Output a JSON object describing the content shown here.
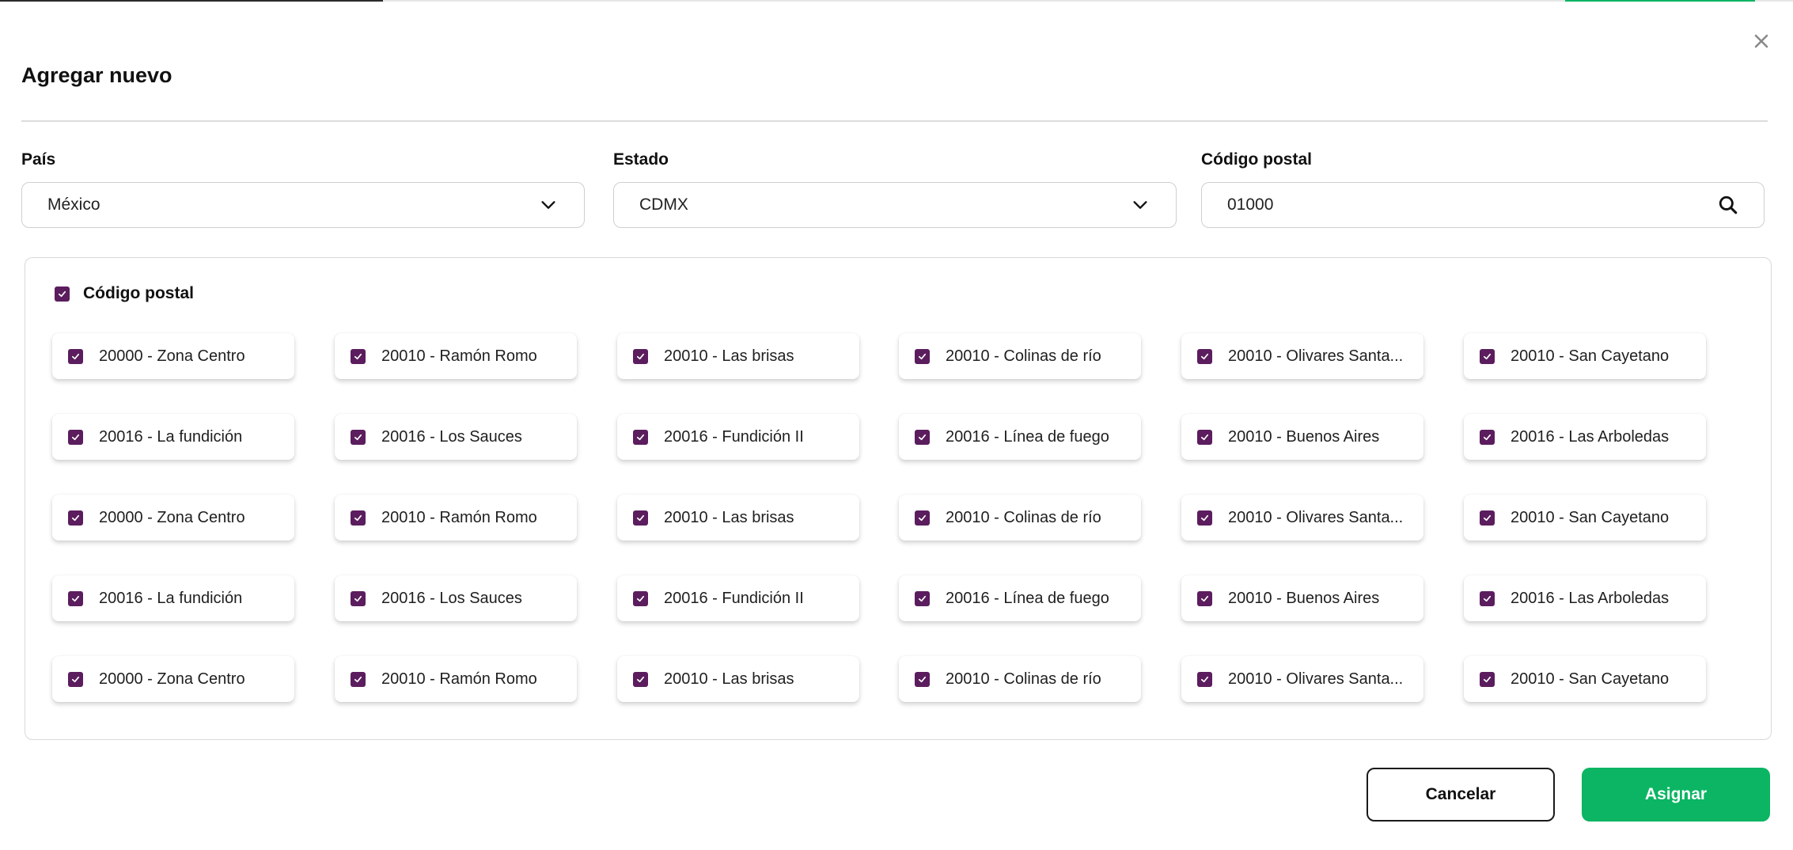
{
  "modal": {
    "title": "Agregar nuevo"
  },
  "fields": {
    "pais": {
      "label": "País",
      "value": "México"
    },
    "estado": {
      "label": "Estado",
      "value": "CDMX"
    },
    "codigo_postal": {
      "label": "Código postal",
      "value": "01000"
    }
  },
  "panel": {
    "header_label": "Código postal",
    "header_checked": true
  },
  "chips": [
    [
      "20000 - Zona Centro",
      "20010 - Ramón Romo",
      "20010 - Las brisas",
      "20010 - Colinas de río",
      "20010 - Olivares Santa...",
      "20010 - San Cayetano"
    ],
    [
      "20016 - La fundición",
      "20016 - Los Sauces",
      "20016 - Fundición II",
      "20016 - Línea de fuego",
      "20010 - Buenos Aires",
      "20016 - Las Arboledas"
    ],
    [
      "20000 - Zona Centro",
      "20010 - Ramón Romo",
      "20010 - Las brisas",
      "20010 - Colinas de río",
      "20010 - Olivares Santa...",
      "20010 - San Cayetano"
    ],
    [
      "20016 - La fundición",
      "20016 - Los Sauces",
      "20016 - Fundición II",
      "20016 - Línea de fuego",
      "20010 - Buenos Aires",
      "20016 - Las Arboledas"
    ],
    [
      "20000 - Zona Centro",
      "20010 - Ramón Romo",
      "20010 - Las brisas",
      "20010 - Colinas de río",
      "20010 - Olivares Santa...",
      "20010 - San Cayetano"
    ]
  ],
  "buttons": {
    "cancel": "Cancelar",
    "assign": "Asignar"
  },
  "colors": {
    "accent_green": "#0bb563",
    "checkbox_purple": "#5b1d5e"
  },
  "icons": {
    "close": "close-icon",
    "dropdown": "chevron-down-icon",
    "search": "search-icon",
    "check": "check-icon"
  }
}
